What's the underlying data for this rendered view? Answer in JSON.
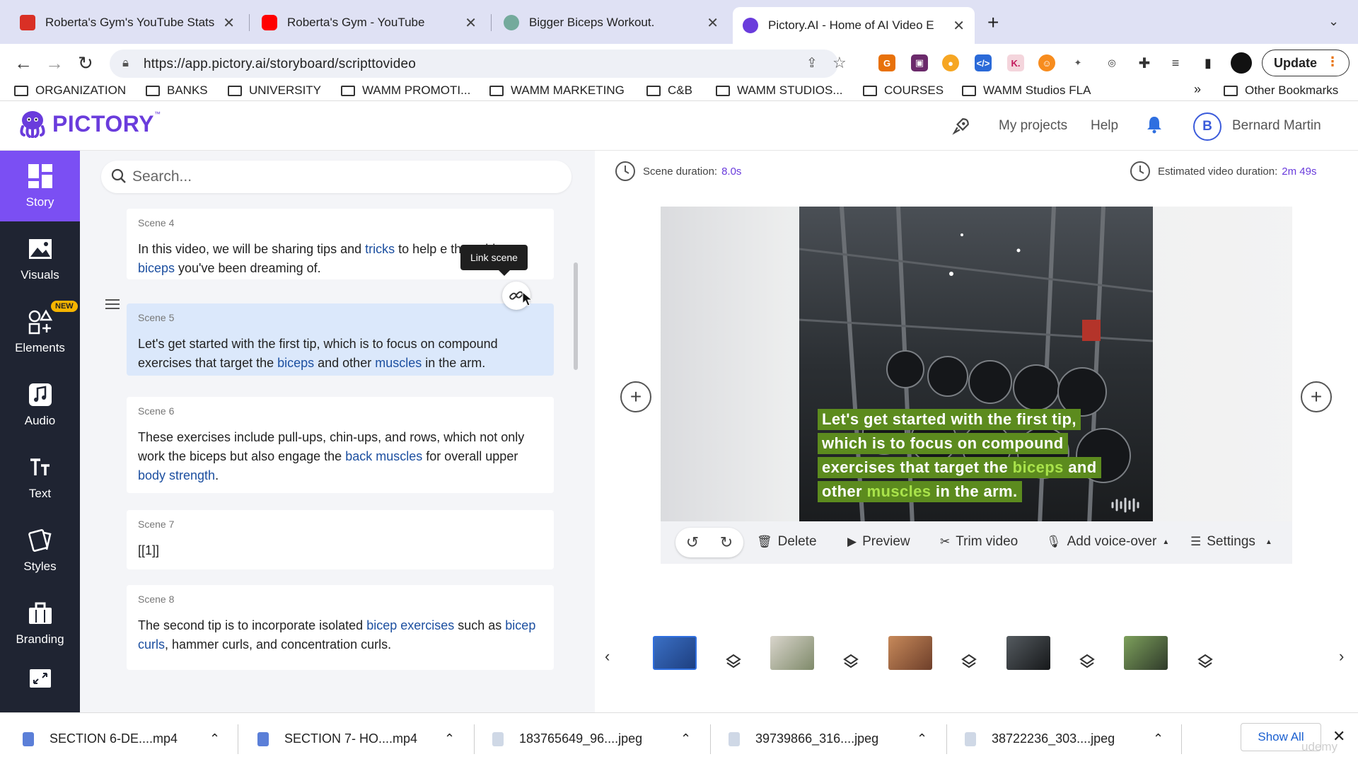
{
  "browser": {
    "tabs": [
      {
        "title": "Roberta's Gym's YouTube Stats",
        "icon": "bar-chart-favicon",
        "color": "#d93025"
      },
      {
        "title": "Roberta's Gym - YouTube",
        "icon": "youtube-favicon",
        "color": "#ff0000"
      },
      {
        "title": "Bigger Biceps Workout.",
        "icon": "chatgpt-favicon",
        "color": "#74aa9c"
      },
      {
        "title": "Pictory.AI - Home of AI Video E",
        "icon": "pictory-favicon",
        "color": "#6a3cdc"
      }
    ],
    "url": "https://app.pictory.ai/storyboard/scripttovideo",
    "update_label": "Update",
    "bookmarks": [
      "ORGANIZATION",
      "BANKS",
      "UNIVERSITY",
      "WAMM PROMOTI...",
      "WAMM MARKETING",
      "C&B",
      "WAMM STUDIOS...",
      "COURSES",
      "WAMM Studios FLA"
    ],
    "other_bookmarks": "Other Bookmarks",
    "bookmarks_more": "»"
  },
  "header": {
    "brand": "PICTORY",
    "brand_tm": "™",
    "my_projects": "My projects",
    "help": "Help",
    "avatar_initial": "B",
    "user_name": "Bernard Martin"
  },
  "sidebar": {
    "items": [
      {
        "label": "Story",
        "icon": "story-icon"
      },
      {
        "label": "Visuals",
        "icon": "image-icon"
      },
      {
        "label": "Elements",
        "icon": "shapes-icon"
      },
      {
        "label": "Audio",
        "icon": "music-icon"
      },
      {
        "label": "Text",
        "icon": "text-icon"
      },
      {
        "label": "Styles",
        "icon": "styles-icon"
      },
      {
        "label": "Branding",
        "icon": "briefcase-icon"
      }
    ],
    "new_badge": "NEW"
  },
  "script": {
    "search_placeholder": "Search...",
    "tooltip": "Link scene",
    "scenes": [
      {
        "label": "Scene 4"
      },
      {
        "label": "Scene 5"
      },
      {
        "label": "Scene 6"
      },
      {
        "label": "Scene 7",
        "text": "[[1]]"
      },
      {
        "label": "Scene 8"
      }
    ]
  },
  "preview": {
    "scene_duration_label": "Scene duration:",
    "scene_duration": "8.0s",
    "estimated_label": "Estimated video duration:",
    "estimated": "2m 49s",
    "caption_lines": [
      "Let's get started with the first tip,",
      "which is to focus on compound",
      "exercises that target the biceps and",
      "other muscles in the arm."
    ],
    "toolbar": {
      "delete": "Delete",
      "preview": "Preview",
      "trim": "Trim video",
      "voice": "Add voice-over",
      "settings": "Settings"
    }
  },
  "downloads": {
    "items": [
      "SECTION 6-DE....mp4",
      "SECTION 7- HO....mp4",
      "183765649_96....jpeg",
      "39739866_316....jpeg",
      "38722236_303....jpeg"
    ],
    "show_all": "Show All",
    "watermark": "udemy"
  },
  "colors": {
    "accent": "#6a3cdc",
    "sidebar": "#1f2432",
    "sidebar_active": "#7b4ff3",
    "keyword": "#1c4fa0",
    "caption_bg": "#5c8b1e"
  }
}
